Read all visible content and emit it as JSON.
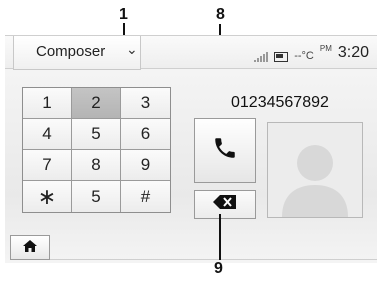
{
  "callouts": {
    "c1": "1",
    "c8": "8",
    "c9": "9"
  },
  "header": {
    "tab_label": "Composer",
    "status": {
      "temperature": "--°C",
      "ampm": "PM",
      "time": "3:20"
    }
  },
  "keypad": {
    "keys": [
      "1",
      "2",
      "3",
      "4",
      "5",
      "6",
      "7",
      "8",
      "9",
      "∗",
      "5",
      "#"
    ],
    "selected_key": "2"
  },
  "dialer": {
    "number": "01234567892"
  },
  "icons": {
    "tab": "chevron-down-icon",
    "signal": "signal-bars-icon",
    "battery": "battery-icon",
    "call": "phone-handset-icon",
    "delete": "backspace-icon",
    "home": "home-icon",
    "contact": "contact-silhouette-icon"
  }
}
